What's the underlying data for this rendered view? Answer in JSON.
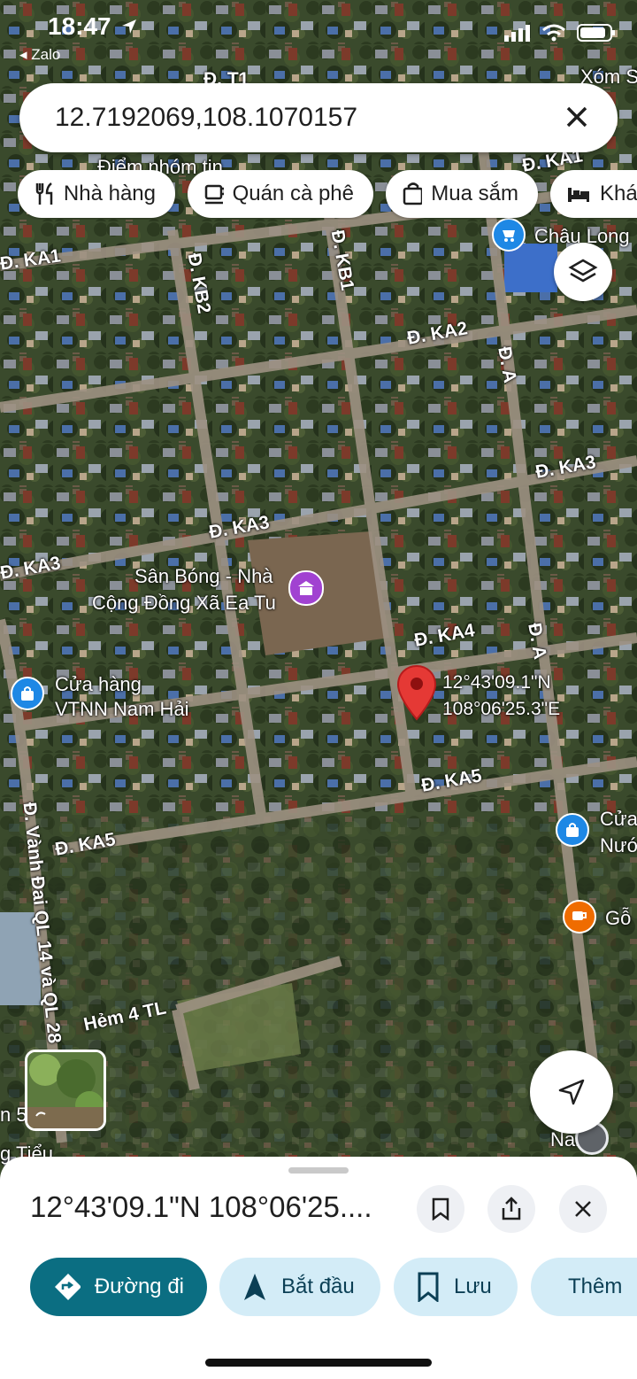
{
  "status_bar": {
    "time": "18:47",
    "back_app": "Zalo"
  },
  "search": {
    "query": "12.7192069,108.1070157"
  },
  "chips": [
    {
      "label": "Nhà hàng",
      "icon": "restaurant-icon"
    },
    {
      "label": "Quán cà phê",
      "icon": "coffee-icon"
    },
    {
      "label": "Mua sắm",
      "icon": "shopping-bag-icon"
    },
    {
      "label": "Khác",
      "icon": "bed-icon"
    }
  ],
  "map": {
    "street_labels": [
      "Đ. T1",
      "Đ. KA1",
      "Đ. KA1",
      "Đ. KB2",
      "Đ. KB1",
      "Đ. KA2",
      "Đ. A",
      "Đ. KA3",
      "Đ. KA3",
      "Đ. KA3",
      "Đ. KA4",
      "Đ. A",
      "Đ. KA5",
      "Đ. KA5",
      "Đ. Vành Đai QL 14 và QL 28",
      "Hẻm 4 TL"
    ],
    "place_labels": [
      "Xóm S",
      "Điểm nhóm tin",
      "Châu Long",
      "Sân Bóng - Nhà",
      "Cộng Đồng Xã Ea Tu",
      "Cửa hàng",
      "VTNN Nam Hải",
      "Cửa",
      "Nướ",
      "Gỗ",
      "Nari",
      "n 5",
      "g Tiểu"
    ],
    "pin_coords": [
      "12°43'09.1\"N",
      "108°06'25.3\"E"
    ]
  },
  "place_sheet": {
    "title": "12°43'09.1\"N 108°06'25....",
    "actions": [
      {
        "label": "Đường đi",
        "icon": "directions-icon"
      },
      {
        "label": "Bắt đầu",
        "icon": "navigation-arrow-icon"
      },
      {
        "label": "Lưu",
        "icon": "bookmark-icon"
      },
      {
        "label": "Thêm",
        "icon": "flag-icon"
      }
    ]
  },
  "colors": {
    "primary": "#0b6e82",
    "secondary_bg": "#d3ecf7",
    "pin": "#e53935",
    "poi_store": "#1e88e5",
    "poi_cafe": "#ef6c00",
    "poi_civic": "#a142d1"
  }
}
